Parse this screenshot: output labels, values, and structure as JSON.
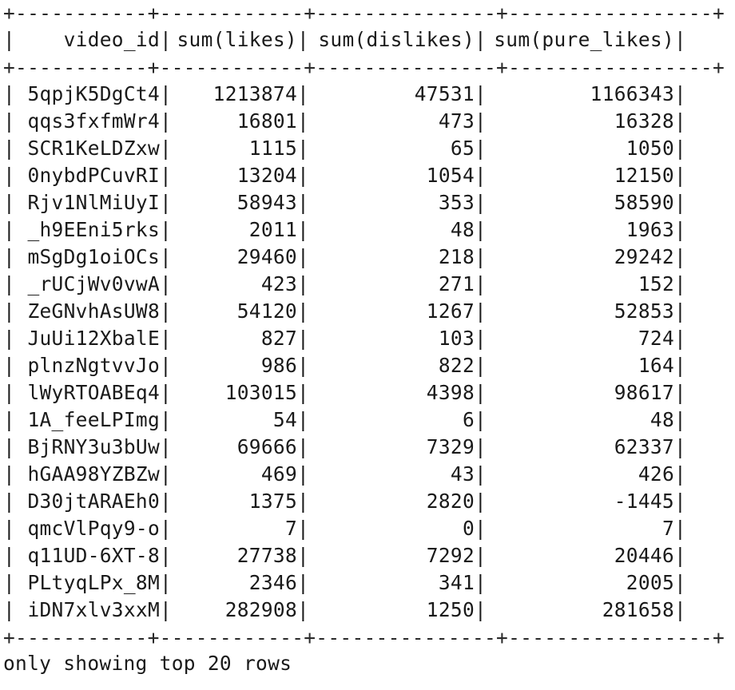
{
  "table": {
    "border_line": "+-----------+------------+---------------+-----------------+",
    "headers": [
      "video_id",
      "sum(likes)",
      "sum(dislikes)",
      "sum(pure_likes)"
    ],
    "rows": [
      [
        "5qpjK5DgCt4",
        "1213874",
        "47531",
        "1166343"
      ],
      [
        "qqs3fxfmWr4",
        "16801",
        "473",
        "16328"
      ],
      [
        "SCR1KeLDZxw",
        "1115",
        "65",
        "1050"
      ],
      [
        "0nybdPCuvRI",
        "13204",
        "1054",
        "12150"
      ],
      [
        "Rjv1NlMiUyI",
        "58943",
        "353",
        "58590"
      ],
      [
        "_h9EEni5rks",
        "2011",
        "48",
        "1963"
      ],
      [
        "mSgDg1oiOCs",
        "29460",
        "218",
        "29242"
      ],
      [
        "_rUCjWv0vwA",
        "423",
        "271",
        "152"
      ],
      [
        "ZeGNvhAsUW8",
        "54120",
        "1267",
        "52853"
      ],
      [
        "JuUi12XbalE",
        "827",
        "103",
        "724"
      ],
      [
        "plnzNgtvvJo",
        "986",
        "822",
        "164"
      ],
      [
        "lWyRTOABEq4",
        "103015",
        "4398",
        "98617"
      ],
      [
        "1A_feeLPImg",
        "54",
        "6",
        "48"
      ],
      [
        "BjRNY3u3bUw",
        "69666",
        "7329",
        "62337"
      ],
      [
        "hGAA98YZBZw",
        "469",
        "43",
        "426"
      ],
      [
        "D30jtARAEh0",
        "1375",
        "2820",
        "-1445"
      ],
      [
        "qmcVlPqy9-o",
        "7",
        "0",
        "7"
      ],
      [
        "q11UD-6XT-8",
        "27738",
        "7292",
        "20446"
      ],
      [
        "PLtyqLPx_8M",
        "2346",
        "341",
        "2005"
      ],
      [
        "iDN7xlv3xxM",
        "282908",
        "1250",
        "281658"
      ]
    ]
  },
  "footer_text": "only showing top 20 rows"
}
